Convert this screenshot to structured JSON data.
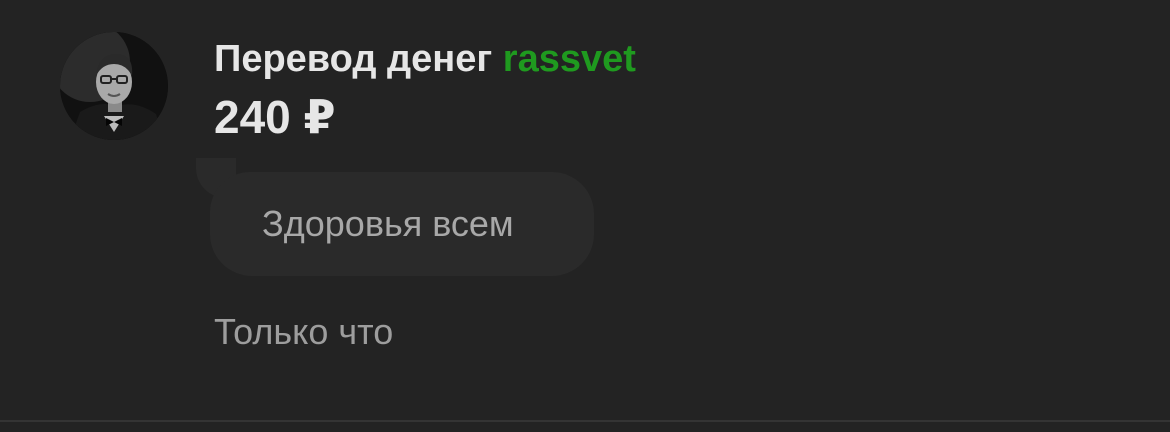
{
  "transfer": {
    "title_prefix": "Перевод денег",
    "sender_name": "rassvet",
    "amount": "240 ₽",
    "message": "Здоровья всем",
    "timestamp": "Только что"
  },
  "colors": {
    "background": "#232323",
    "sender_accent": "#1f9a1f",
    "bubble": "#2a2a2a"
  },
  "icons": {
    "avatar": "user-avatar"
  }
}
